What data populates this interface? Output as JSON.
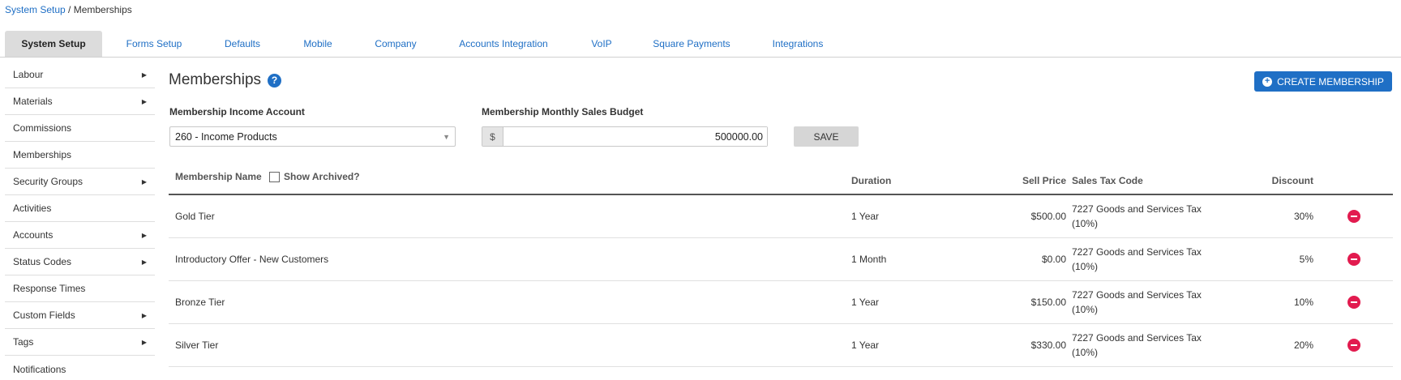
{
  "breadcrumb": {
    "parent": "System Setup",
    "separator": " / ",
    "current": "Memberships"
  },
  "tabs": [
    {
      "label": "System Setup",
      "active": true
    },
    {
      "label": "Forms Setup"
    },
    {
      "label": "Defaults"
    },
    {
      "label": "Mobile"
    },
    {
      "label": "Company"
    },
    {
      "label": "Accounts Integration"
    },
    {
      "label": "VoIP"
    },
    {
      "label": "Square Payments"
    },
    {
      "label": "Integrations"
    }
  ],
  "sidebar": {
    "items": [
      {
        "label": "Labour",
        "has_submenu": true
      },
      {
        "label": "Materials",
        "has_submenu": true
      },
      {
        "label": "Commissions",
        "has_submenu": false
      },
      {
        "label": "Memberships",
        "has_submenu": false
      },
      {
        "label": "Security Groups",
        "has_submenu": true
      },
      {
        "label": "Activities",
        "has_submenu": false
      },
      {
        "label": "Accounts",
        "has_submenu": true
      },
      {
        "label": "Status Codes",
        "has_submenu": true
      },
      {
        "label": "Response Times",
        "has_submenu": false
      },
      {
        "label": "Custom Fields",
        "has_submenu": true
      },
      {
        "label": "Tags",
        "has_submenu": true
      },
      {
        "label": "Notifications",
        "has_submenu": false
      }
    ]
  },
  "main": {
    "title": "Memberships",
    "help_glyph": "?",
    "create_button_label": "CREATE MEMBERSHIP",
    "income_account": {
      "label": "Membership Income Account",
      "value": "260 - Income Products"
    },
    "sales_budget": {
      "label": "Membership Monthly Sales Budget",
      "currency": "$",
      "value": "500000.00"
    },
    "save_label": "SAVE"
  },
  "table": {
    "headers": {
      "name": "Membership Name",
      "show_archived": "Show Archived?",
      "duration": "Duration",
      "sell_price": "Sell Price",
      "tax_code": "Sales Tax Code",
      "discount": "Discount"
    },
    "rows": [
      {
        "name": "Gold Tier",
        "duration": "1 Year",
        "price": "$500.00",
        "tax_line1": "7227 Goods and Services Tax",
        "tax_line2": "(10%)",
        "discount": "30%"
      },
      {
        "name": "Introductory Offer - New Customers",
        "duration": "1 Month",
        "price": "$0.00",
        "tax_line1": "7227 Goods and Services Tax",
        "tax_line2": "(10%)",
        "discount": "5%"
      },
      {
        "name": "Bronze Tier",
        "duration": "1 Year",
        "price": "$150.00",
        "tax_line1": "7227 Goods and Services Tax",
        "tax_line2": "(10%)",
        "discount": "10%"
      },
      {
        "name": "Silver Tier",
        "duration": "1 Year",
        "price": "$330.00",
        "tax_line1": "7227 Goods and Services Tax",
        "tax_line2": "(10%)",
        "discount": "20%"
      }
    ]
  },
  "colors": {
    "accent": "#1f6fc5",
    "danger": "#e21b4f",
    "active_tab": "#dcdcdc"
  }
}
